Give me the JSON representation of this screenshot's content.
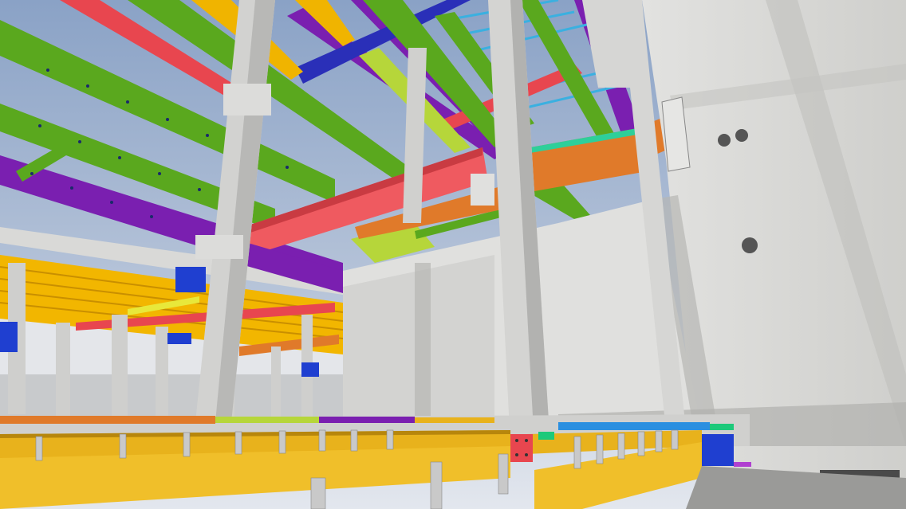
{
  "scene": {
    "kind": "3D BIM render of steel and precast concrete structure",
    "colors": {
      "sky_top": "#8fa6c8",
      "sky_bottom": "#d9e0ea",
      "concrete": "#d8d8d6",
      "concrete_shadow": "#a9a9a7",
      "beam_green": "#5aa81e",
      "beam_purple": "#7a1fb0",
      "beam_red": "#e8464f",
      "beam_yellow": "#f0b400",
      "beam_orange": "#e07a2a",
      "beam_blue": "#2a2fb8",
      "beam_lime": "#b6d63a",
      "bracket_blue": "#1f3fd0",
      "floor_yellow": "#e8b21c"
    }
  }
}
